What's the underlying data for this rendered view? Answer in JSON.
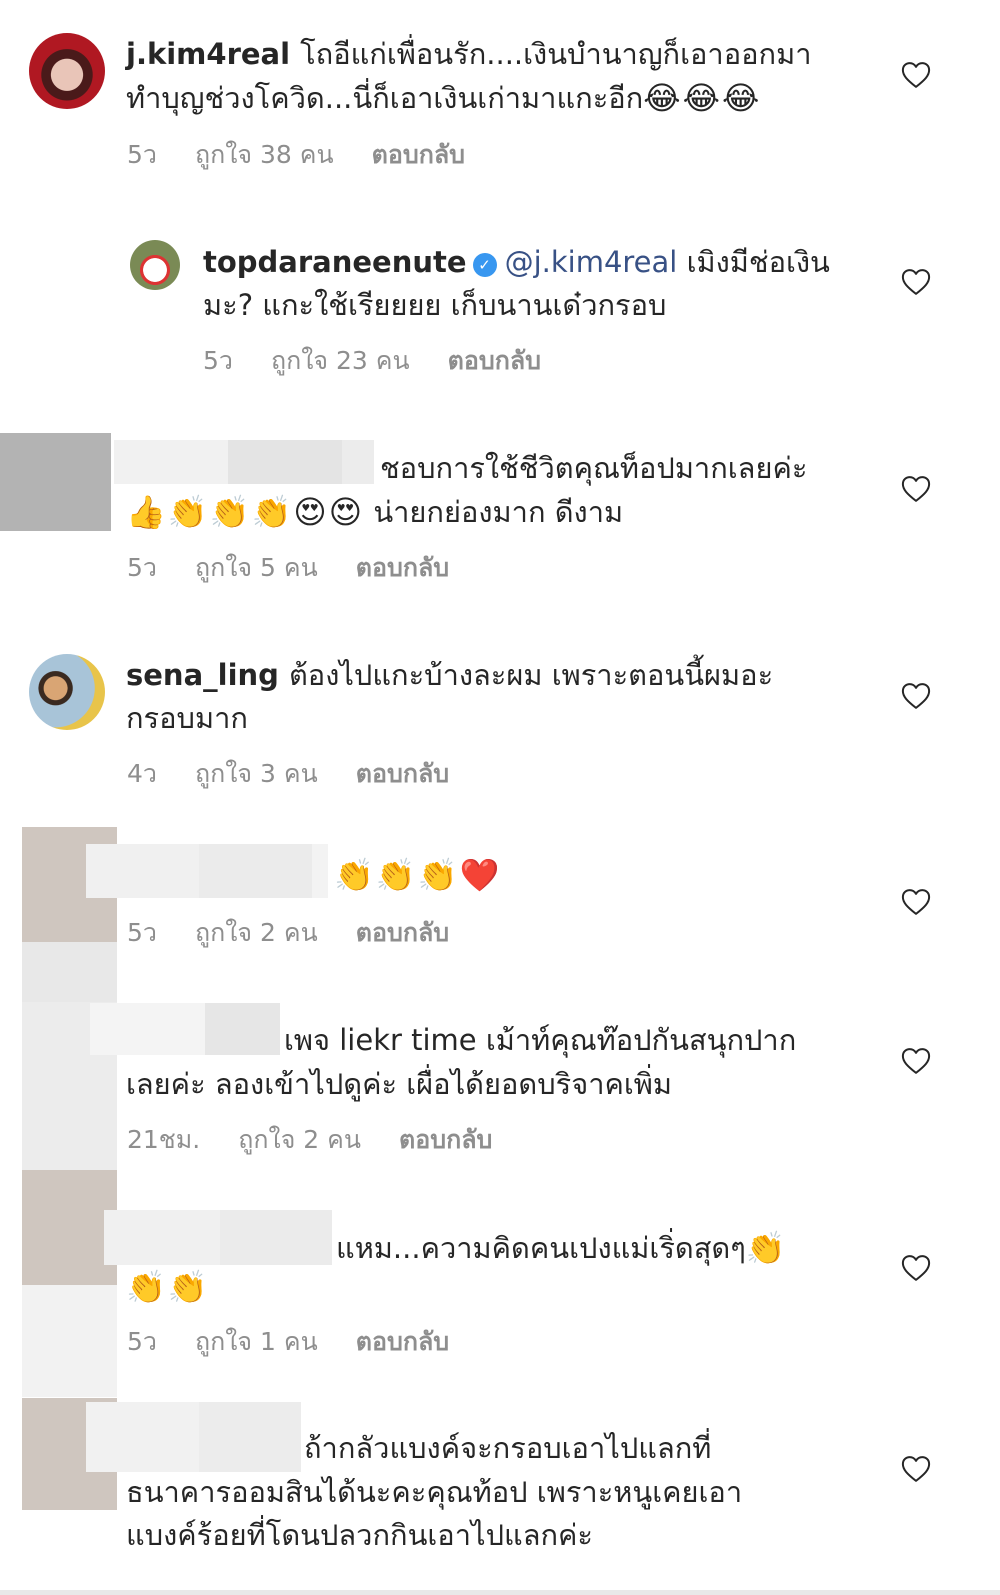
{
  "comments": [
    {
      "username": "j.kim4real",
      "line1": "โถอีแก่เพื่อนรัก....เงินบำนาญก็เอาออกมา",
      "line2": "ทำบุญช่วงโควิด...นี่ก็เอาเงินเก่ามาแกะอีก",
      "emojis": [
        "😂",
        "😂",
        "😂"
      ],
      "time": "5ว",
      "likes": "ถูกใจ 38 คน",
      "reply": "ตอบกลับ"
    },
    {
      "username": "topdaraneenute",
      "verified": true,
      "mention": "@j.kim4real",
      "line1_rest": "เมิงมีช่อเงิน",
      "line2": "มะ? แกะใช้เรียยยย เก็บนานเด๋วกรอบ",
      "time": "5ว",
      "likes": "ถูกใจ 23 คน",
      "reply": "ตอบกลับ"
    },
    {
      "line1": "ชอบการใช้ชีวิตคุณท็อปมากเลยค่ะ",
      "emojis": [
        "👍",
        "👏",
        "👏",
        "👏",
        "😍",
        "😍"
      ],
      "line2": "น่ายกย่องมาก ดีงาม",
      "time": "5ว",
      "likes": "ถูกใจ 5 คน",
      "reply": "ตอบกลับ"
    },
    {
      "username": "sena_ling",
      "line1": "ต้องไปแกะบ้างละผม เพราะตอนนี้ผมอะ",
      "line2": "กรอบมาก",
      "time": "4ว",
      "likes": "ถูกใจ 3 คน",
      "reply": "ตอบกลับ"
    },
    {
      "emojis": [
        "👏",
        "👏",
        "👏",
        "❤️"
      ],
      "time": "5ว",
      "likes": "ถูกใจ 2 คน",
      "reply": "ตอบกลับ"
    },
    {
      "line1": "เพจ liekr time เม้าท์คุณท๊อปกันสนุกปาก",
      "line2": "เลยค่ะ ลองเข้าไปดูค่ะ เผื่อได้ยอดบริจาคเพิ่ม",
      "time": "21ชม.",
      "likes": "ถูกใจ 2 คน",
      "reply": "ตอบกลับ"
    },
    {
      "line1": "แหม...ความคิดคนเปงแม่เริ่ดสุดๆ",
      "emojis_line1": [
        "👏"
      ],
      "emojis_line2": [
        "👏",
        "👏"
      ],
      "time": "5ว",
      "likes": "ถูกใจ 1 คน",
      "reply": "ตอบกลับ"
    },
    {
      "line1": "ถ้ากลัวแบงค์จะกรอบเอาไปแลกที่",
      "line2": "ธนาคารออมสินได้นะคะคุณท้อป เพราะหนูเคยเอา",
      "line3": "แบงค์ร้อยที่โดนปลวกกินเอาไปแลกค่ะ"
    }
  ],
  "colors": {
    "text": "#262626",
    "meta": "#8e8e8e",
    "mention": "#385185",
    "verified": "#3897f0"
  },
  "icons": {
    "like": "heart-outline-icon",
    "verified": "verified-badge-icon"
  }
}
